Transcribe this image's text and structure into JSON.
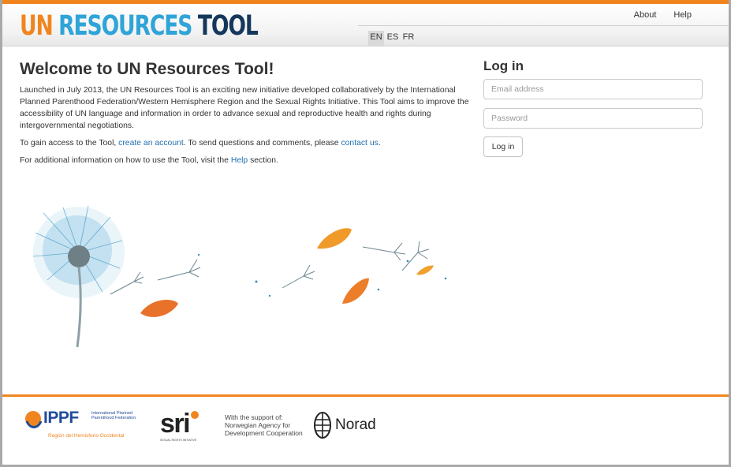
{
  "header": {
    "logo_un": "UN",
    "logo_resources": "RESOURCES",
    "logo_tool": "TOOL",
    "nav": {
      "about": "About",
      "help": "Help"
    },
    "languages": [
      "EN",
      "ES",
      "FR"
    ],
    "active_language": "EN"
  },
  "main": {
    "title": "Welcome to UN Resources Tool!",
    "intro": "Launched in July 2013, the UN Resources Tool is an exciting new initiative developed collaboratively by the International Planned Parenthood Federation/Western Hemisphere Region and the Sexual Rights Initiative. This Tool aims to improve the accessibility of UN language and information in order to advance sexual and reproductive health and rights during intergovernmental negotiations.",
    "access": {
      "prefix": "To gain access to the Tool, ",
      "create_link": "create an account",
      "middle": ". To send questions and comments, please ",
      "contact_link": "contact us",
      "suffix": "."
    },
    "help_line": {
      "prefix": "For additional information on how to use the Tool, visit the ",
      "help_link": "Help",
      "suffix": " section."
    }
  },
  "login": {
    "title": "Log in",
    "email_placeholder": "Email address",
    "password_placeholder": "Password",
    "button_label": "Log in"
  },
  "footer": {
    "ippf_name": "IPPF",
    "ippf_full": "International Planned Parenthood Federation",
    "ippf_region": "Región del Hemisferio Occidental",
    "sri_name": "sri",
    "sri_full": "SEXUAL RIGHTS INITIATIVE",
    "support_text": "With the support of: Norwegian Agency for Development Cooperation",
    "norad_name": "Norad"
  },
  "colors": {
    "accent_orange": "#f0851f",
    "logo_blue": "#2fa4d8",
    "logo_navy": "#15375c",
    "link_blue": "#1f6fb0"
  }
}
